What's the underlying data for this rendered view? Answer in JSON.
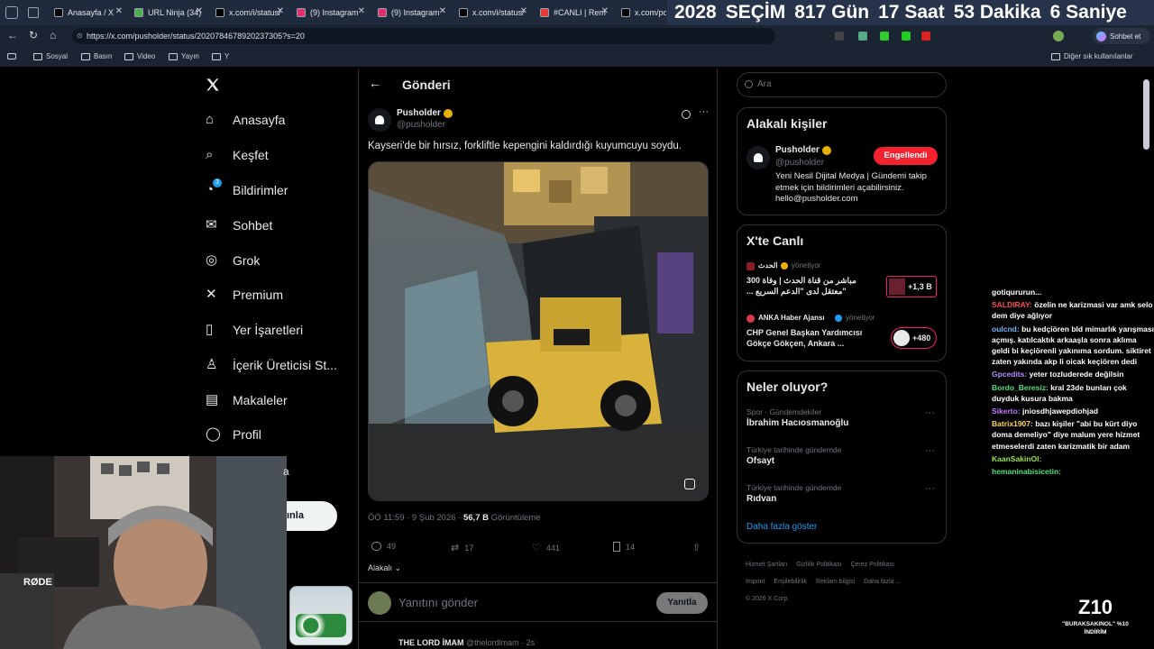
{
  "browser": {
    "tabs": [
      {
        "label": "Anasayfa / X",
        "color": "#000000"
      },
      {
        "label": "URL Ninja (34)",
        "color": "#4caf50"
      },
      {
        "label": "x.com/i/status/",
        "color": "#000000"
      },
      {
        "label": "(9) Instagram",
        "color": "#e1306c"
      },
      {
        "label": "(9) Instagram",
        "color": "#e1306c"
      },
      {
        "label": "x.com/i/status/",
        "color": "#000000"
      },
      {
        "label": "#CANLI | Rem",
        "color": "#e53935"
      },
      {
        "label": "x.com/po",
        "color": "#000000"
      }
    ],
    "url": "https://x.com/pusholder/status/2020784678920237305?s=20",
    "chat_button": "Sohbet et",
    "bookmarks": [
      "Sosyal",
      "Basın",
      "Video",
      "Yayın",
      "Y"
    ],
    "other_bookmarks": "Diğer sık kullanılanlar"
  },
  "countdown": {
    "year": "2028",
    "label": "SEÇİM",
    "days": "817",
    "days_unit": "Gün",
    "hours": "17",
    "hours_unit": "Saat",
    "minutes": "53",
    "minutes_unit": "Dakika",
    "seconds": "6",
    "seconds_unit": "Saniye"
  },
  "nav": {
    "items": [
      "Anasayfa",
      "Keşfet",
      "Bildirimler",
      "Sohbet",
      "Grok",
      "Premium",
      "Yer İşaretleri",
      "İçerik Üreticisi St...",
      "Makaleler",
      "Profil"
    ],
    "notification_badge": "3",
    "more_partial": "a",
    "post_partial": "ınla"
  },
  "post": {
    "header": "Gönderi",
    "author_name": "Pusholder",
    "author_handle": "@pusholder",
    "text": "Kayseri'de bir hırsız, forkliftle kepengini kaldırdığı kuyumcuyu soydu.",
    "time": "ÖÖ 11:59 · 9 Şub 2026 ·",
    "views": "56,7 B",
    "views_label": "Görüntüleme",
    "replies": "49",
    "reposts": "17",
    "likes": "441",
    "bookmarks": "14",
    "relevance": "Alakalı",
    "reply_placeholder": "Yanıtını gönder",
    "reply_button": "Yanıtla",
    "next_author": "THE LORD İMAM",
    "next_handle": "@thelordimam · 2s"
  },
  "right": {
    "search_placeholder": "Ara",
    "related_title": "Alakalı kişiler",
    "related_name": "Pusholder",
    "related_handle": "@pusholder",
    "blocked_button": "Engellendi",
    "related_bio": "Yeni Nesil Dijital Medya | Gündemi takip etmek için bildirimleri açabilirsiniz. hello@pusholder.com",
    "live_title": "X'te Canlı",
    "live": [
      {
        "host": "الحدث",
        "role": "yönetiyor",
        "title": "مباشر من قناة الحدث | وفاة 300 \"معتقل لدى \"الدعم السريع ...",
        "count": "+1,3 B"
      },
      {
        "host": "ANKA Haber Ajansı",
        "role": "yönetiyor",
        "title": "CHP Genel Başkan Yardımcısı Gökçe Gökçen, Ankara ...",
        "count": "+480"
      }
    ],
    "trends_title": "Neler oluyor?",
    "trends": [
      {
        "context": "Spor · Gündemdekiler",
        "name": "İbrahim Hacıosmanoğlu"
      },
      {
        "context": "Türkiye tarihinde gündemde",
        "name": "Ofsayt"
      },
      {
        "context": "Türkiye tarihinde gündemde",
        "name": "Rıdvan"
      }
    ],
    "show_more": "Daha fazla göster",
    "footer": [
      "Hizmet Şartları",
      "Gizlilik Politikası",
      "Çerez Politikası",
      "Imprint",
      "Erişilebilirlik",
      "Reklam bilgisi",
      "Daha fazla ...",
      "© 2026 X Corp."
    ]
  },
  "chat": [
    {
      "user": "",
      "text": "gotiqururun...",
      "color": "#ffffff"
    },
    {
      "user": "SALDIRAY:",
      "text": "özelin ne karizmasi var amk selo dem diye ağlıyor",
      "color": "#ff4d4d"
    },
    {
      "user": "oulcnd:",
      "text": "bu kedçiören bld mimarlık yarışması açmış. katılcaktık arkaaşla sonra aklıma geldi bi keçiörenli yakınıma sordum. siktiret zaten yakında akp li oicak keçiören dedi",
      "color": "#6fb7ff"
    },
    {
      "user": "Gpcedits:",
      "text": "yeter tozluderede değilsin",
      "color": "#b28cff"
    },
    {
      "user": "Bordo_Beresiz:",
      "text": "kral 23de bunları çok duyduk kusura bakma",
      "color": "#4ee07a"
    },
    {
      "user": "Sikerto:",
      "text": "jniosdhjawepdiohjad",
      "color": "#c07bff"
    },
    {
      "user": "Batrix1907:",
      "text": "bazı kişiler \"abi bu kürt diyo doma demeliyo\" diye malum yere hizmet etmeselerdi zaten karizmatik bir adam",
      "color": "#ffd84d"
    },
    {
      "user": "KaanSakinOl:",
      "text": "",
      "color": "#9be34d"
    },
    {
      "user": "hemaninabisicetin:",
      "text": "",
      "color": "#4ee07a"
    }
  ],
  "overlay": {
    "logo": "Z10",
    "promo": "\"BURAKSAKINOL\" %10 İNDİRİM",
    "mic_brand": "RØDE"
  }
}
